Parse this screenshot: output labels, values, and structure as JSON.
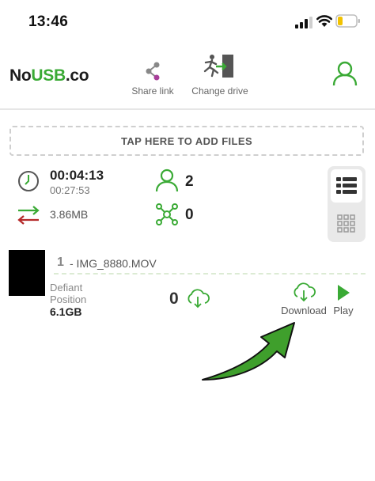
{
  "status_bar": {
    "time": "13:46"
  },
  "header": {
    "logo_prefix": "No",
    "logo_highlight": "USB",
    "logo_suffix": ".co",
    "share_link_label": "Share link",
    "change_drive_label": "Change drive"
  },
  "add_files_label": "TAP HERE TO ADD FILES",
  "stats": {
    "elapsed_time": "00:04:13",
    "remaining_time": "00:27:53",
    "transfer_size": "3.86MB",
    "users_count": "2",
    "connections_count": "0"
  },
  "file": {
    "index": "1",
    "name": " - IMG_8880.MOV",
    "device_line1": "Defiant",
    "device_line2": "Position",
    "size": "6.1GB",
    "download_count": "0",
    "download_label": "Download",
    "play_label": "Play"
  },
  "colors": {
    "accent_green": "#3aaa35",
    "arrow_green": "#3f9f2c",
    "transfer_red": "#b52a2a"
  },
  "icons": [
    "share-icon",
    "change-drive-icon",
    "user-icon",
    "clock-icon",
    "transfer-icon",
    "users-icon",
    "network-icon",
    "list-view-icon",
    "grid-view-icon",
    "cloud-download-icon",
    "play-icon",
    "pointer-arrow"
  ]
}
